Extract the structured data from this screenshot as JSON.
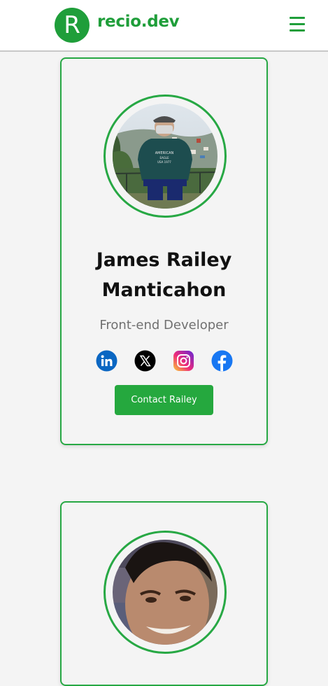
{
  "header": {
    "logo_letter": "R",
    "brand": "recio.dev"
  },
  "cards": [
    {
      "name": "James Railey Manticahon",
      "role": "Front-end Developer",
      "contact_label": "Contact Railey",
      "socials": [
        "linkedin-icon",
        "x-icon",
        "instagram-icon",
        "facebook-icon"
      ]
    }
  ],
  "colors": {
    "brand_green": "#1f9e3a",
    "card_border": "#27a844",
    "button_green": "#25a83e",
    "linkedin": "#0a66c2",
    "facebook": "#1877f2"
  }
}
